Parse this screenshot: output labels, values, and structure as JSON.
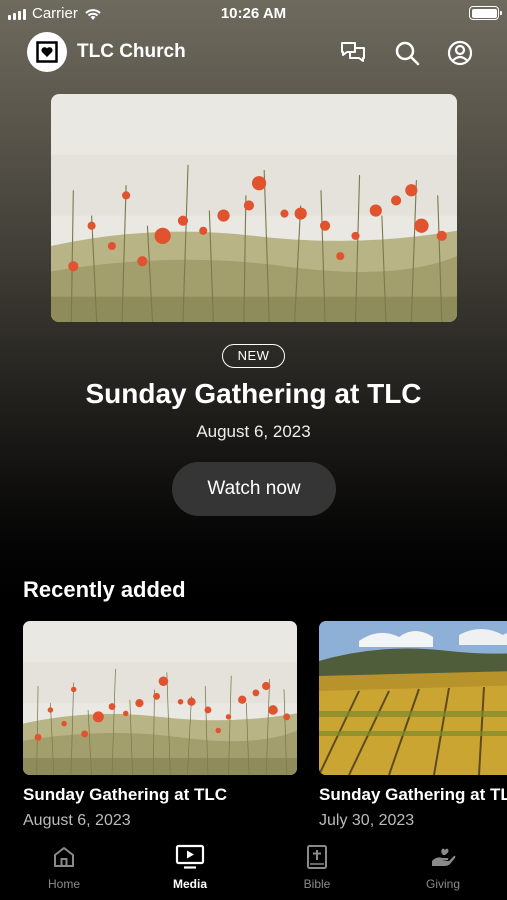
{
  "status_bar": {
    "carrier": "Carrier",
    "time": "10:26 AM"
  },
  "header": {
    "app_title": "TLC Church"
  },
  "hero": {
    "badge": "NEW",
    "title": "Sunday Gathering at TLC",
    "date": "August 6, 2023",
    "watch_label": "Watch now"
  },
  "recent": {
    "section_title": "Recently added",
    "items": [
      {
        "title": "Sunday Gathering at TLC",
        "date": "August 6, 2023"
      },
      {
        "title": "Sunday Gathering at TLC",
        "date": "July 30, 2023"
      }
    ]
  },
  "tabs": [
    {
      "label": "Home",
      "icon": "home-icon",
      "active": false
    },
    {
      "label": "Media",
      "icon": "media-icon",
      "active": true
    },
    {
      "label": "Bible",
      "icon": "bible-icon",
      "active": false
    },
    {
      "label": "Giving",
      "icon": "giving-icon",
      "active": false
    }
  ],
  "colors": {
    "accent": "#ffffff",
    "inactive": "#8a8a8a",
    "button_bg": "#353535"
  }
}
